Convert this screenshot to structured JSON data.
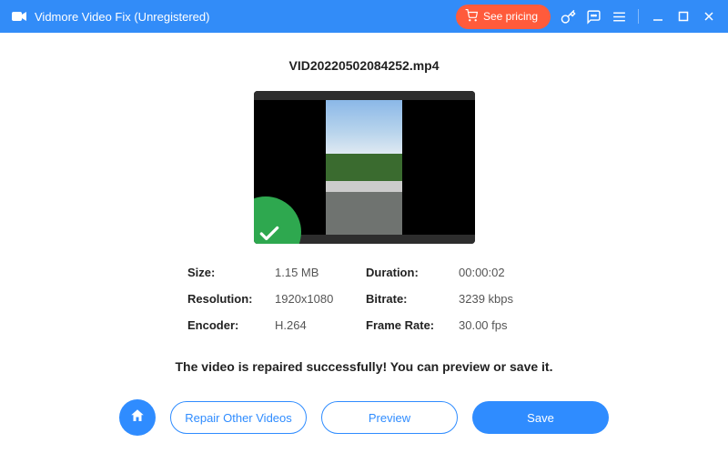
{
  "titlebar": {
    "appTitle": "Vidmore Video Fix (Unregistered)",
    "pricingLabel": "See pricing"
  },
  "main": {
    "filename": "VID20220502084252.mp4",
    "meta": {
      "sizeLabel": "Size:",
      "sizeValue": "1.15 MB",
      "durationLabel": "Duration:",
      "durationValue": "00:00:02",
      "resolutionLabel": "Resolution:",
      "resolutionValue": "1920x1080",
      "bitrateLabel": "Bitrate:",
      "bitrateValue": "3239 kbps",
      "encoderLabel": "Encoder:",
      "encoderValue": "H.264",
      "framerateLabel": "Frame Rate:",
      "framerateValue": "30.00 fps"
    },
    "successMessage": "The video is repaired successfully! You can preview or save it."
  },
  "actions": {
    "repairOther": "Repair Other Videos",
    "preview": "Preview",
    "save": "Save"
  }
}
